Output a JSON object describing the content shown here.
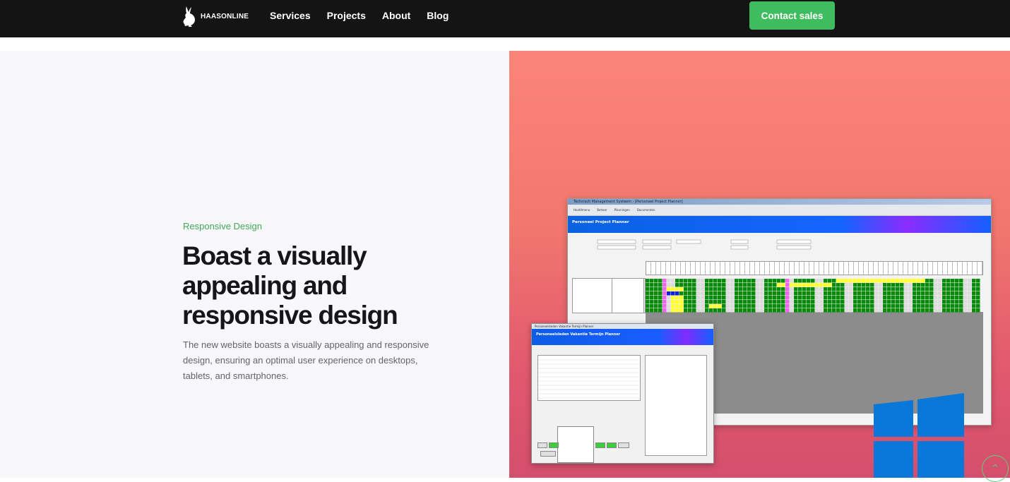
{
  "nav": {
    "brand": "HAASONLINE",
    "links": [
      "Services",
      "Projects",
      "About",
      "Blog"
    ],
    "cta": "Contact sales"
  },
  "hero": {
    "eyebrow": "Responsive Design",
    "headline": "Boast a visually appealing and responsive design",
    "body": "The new website boasts a visually appealing and responsive design, ensuring an optimal user experience on desktops, tablets, and smartphones."
  },
  "screenshot": {
    "main_window_title": "Technisch Management Systeem - [Personeel Project Planner]",
    "main_menu": [
      "Hoofdmenu",
      "Beheer",
      "Planningen",
      "Documenten"
    ],
    "main_banner": "Personeel Project Planner",
    "dialog_title": "Personeelsleden Vakantie Termijn Planner",
    "dialog_banner": "Personeelsleden Vakantie Termijn Planner"
  },
  "colors": {
    "accent": "#3fbc5d",
    "panel_gradient_top": "#fb8479",
    "panel_gradient_bottom": "#d34f6c",
    "windows_blue": "#0078d7"
  },
  "icons": {
    "logo": "rabbit-logo-icon",
    "scroll_top": "arrow-up-icon"
  }
}
